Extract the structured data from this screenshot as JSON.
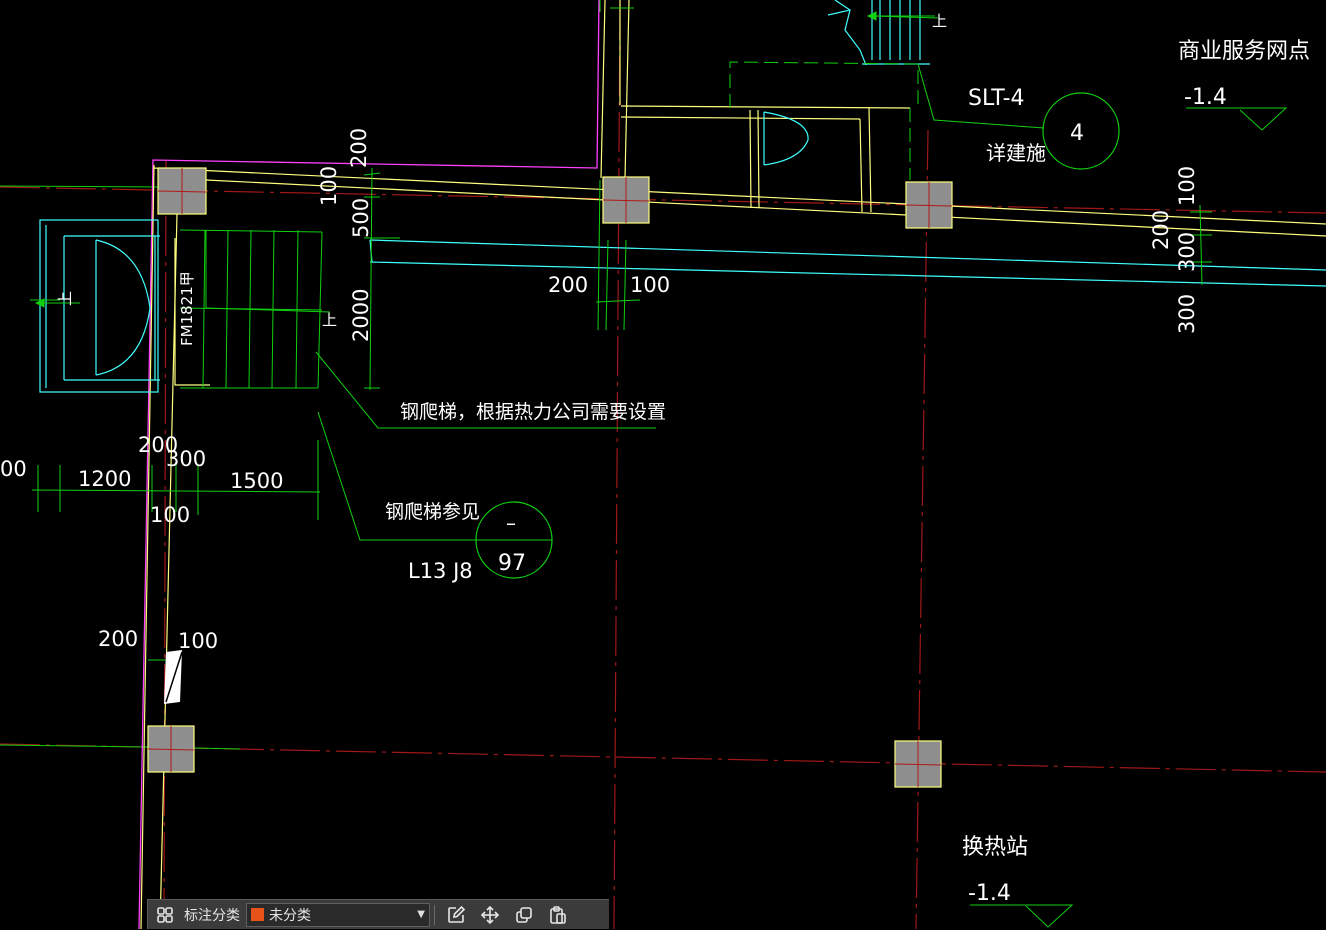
{
  "drawing": {
    "room_commercial": "商业服务网点",
    "elev_commercial": "-1.4",
    "room_heat_station": "换热站",
    "elev_heat_station": "-1.4",
    "ref_slt": "SLT-4",
    "ref_slt_circle": "4",
    "ref_slt_note": "详建施",
    "note_ladder_setup": "钢爬梯，根据热力公司需要设置",
    "note_ladder_ref": "钢爬梯参见",
    "ladder_circle_top": "–",
    "ladder_circle_bottom": "97",
    "ladder_atlas": "L13 J8",
    "door_tag": "FM1821甲",
    "stair_up_main": "上",
    "stair_up_left": "上",
    "stair_up_top": "上",
    "dims": {
      "d200_top": "200",
      "d100_top": "100",
      "d500": "500",
      "d2000": "2000",
      "d200_mid": "200",
      "d100_mid": "100",
      "d100_right": "100",
      "d200_right": "200",
      "d300_right_a": "300",
      "d300_right_b": "300",
      "d200_left": "200",
      "d300_left": "300",
      "d1200": "1200",
      "d1500": "1500",
      "d100_left": "100",
      "d00_edge": "00",
      "d200_low": "200",
      "d100_low": "100"
    }
  },
  "toolbar": {
    "category_label": "标注分类",
    "category_value": "未分类",
    "category_color": "#e8531a"
  },
  "colors": {
    "wall_yellow": "#ffff7f",
    "wall_cyan": "#40ffff",
    "axis_red": "#a01818",
    "green": "#10d010",
    "magenta": "#ff40ff",
    "column_gray": "#909090"
  }
}
